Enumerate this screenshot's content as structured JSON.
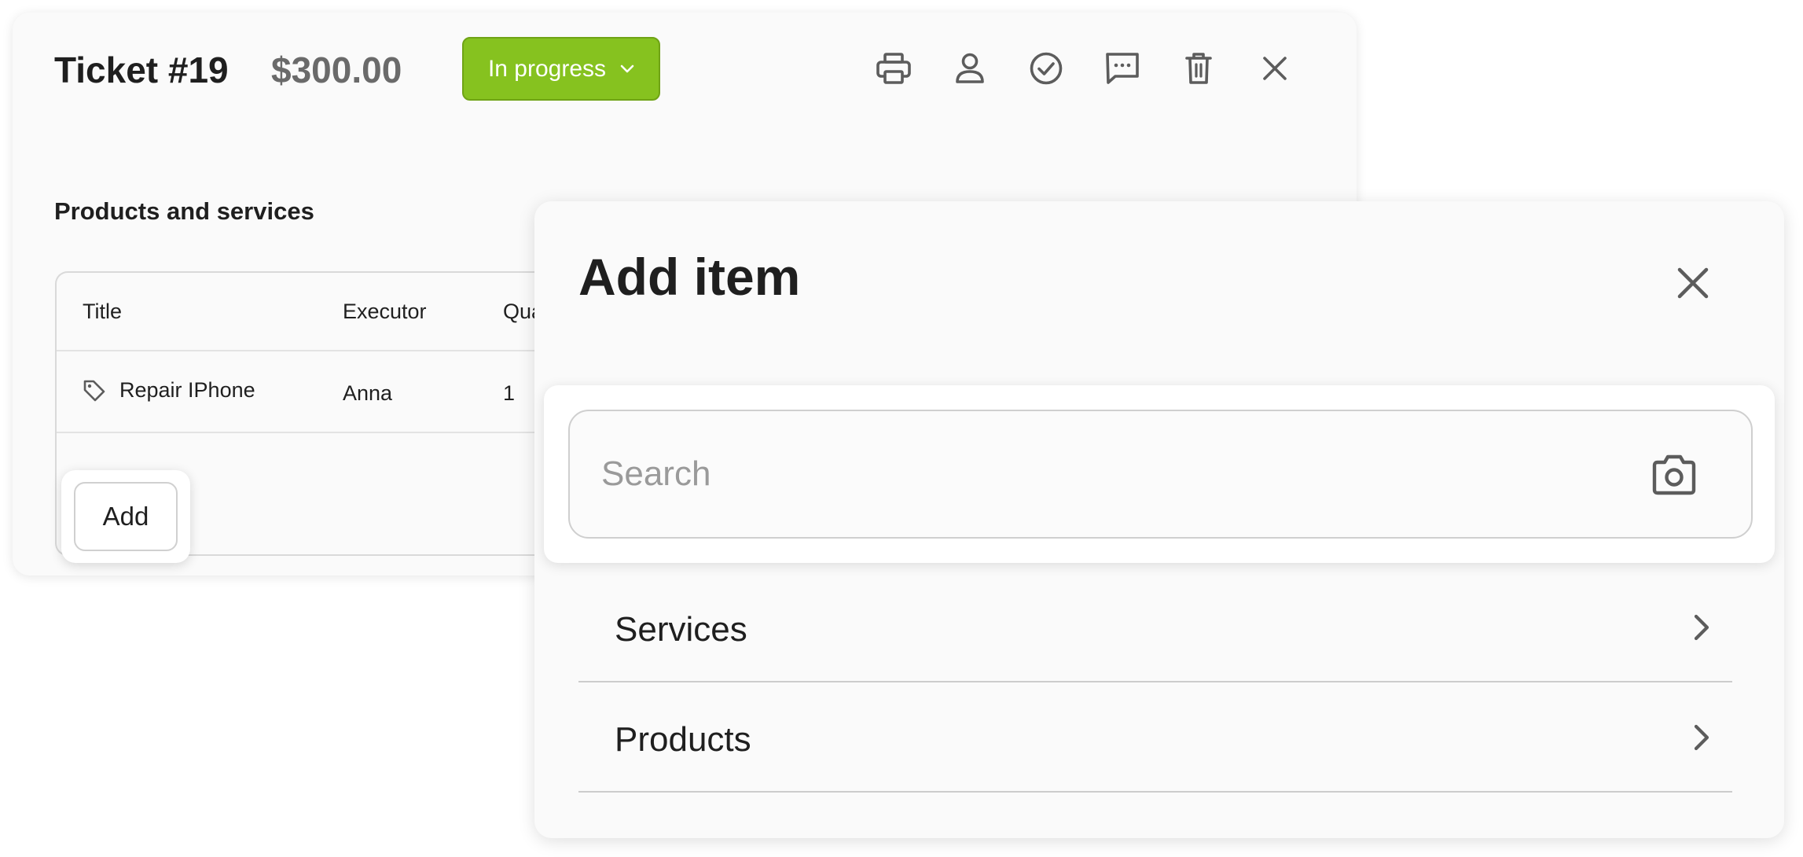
{
  "ticket": {
    "title": "Ticket #19",
    "amount": "$300.00",
    "status": {
      "label": "In progress",
      "color": "#86c21f"
    },
    "toolbar": {
      "icons": [
        "print-icon",
        "user-icon",
        "check-circle-icon",
        "comment-icon",
        "trash-icon",
        "close-icon"
      ]
    },
    "section_heading": "Products and services",
    "table": {
      "headers": [
        "Title",
        "Executor",
        "Qua"
      ],
      "rows": [
        {
          "title": "Repair IPhone",
          "executor": "Anna",
          "quantity": "1",
          "icon": "tag-icon"
        }
      ]
    },
    "add_label": "Add"
  },
  "modal": {
    "title": "Add item",
    "search": {
      "placeholder": "Search",
      "value": "",
      "icon": "camera-icon"
    },
    "items": [
      {
        "label": "Services"
      },
      {
        "label": "Products"
      }
    ]
  }
}
